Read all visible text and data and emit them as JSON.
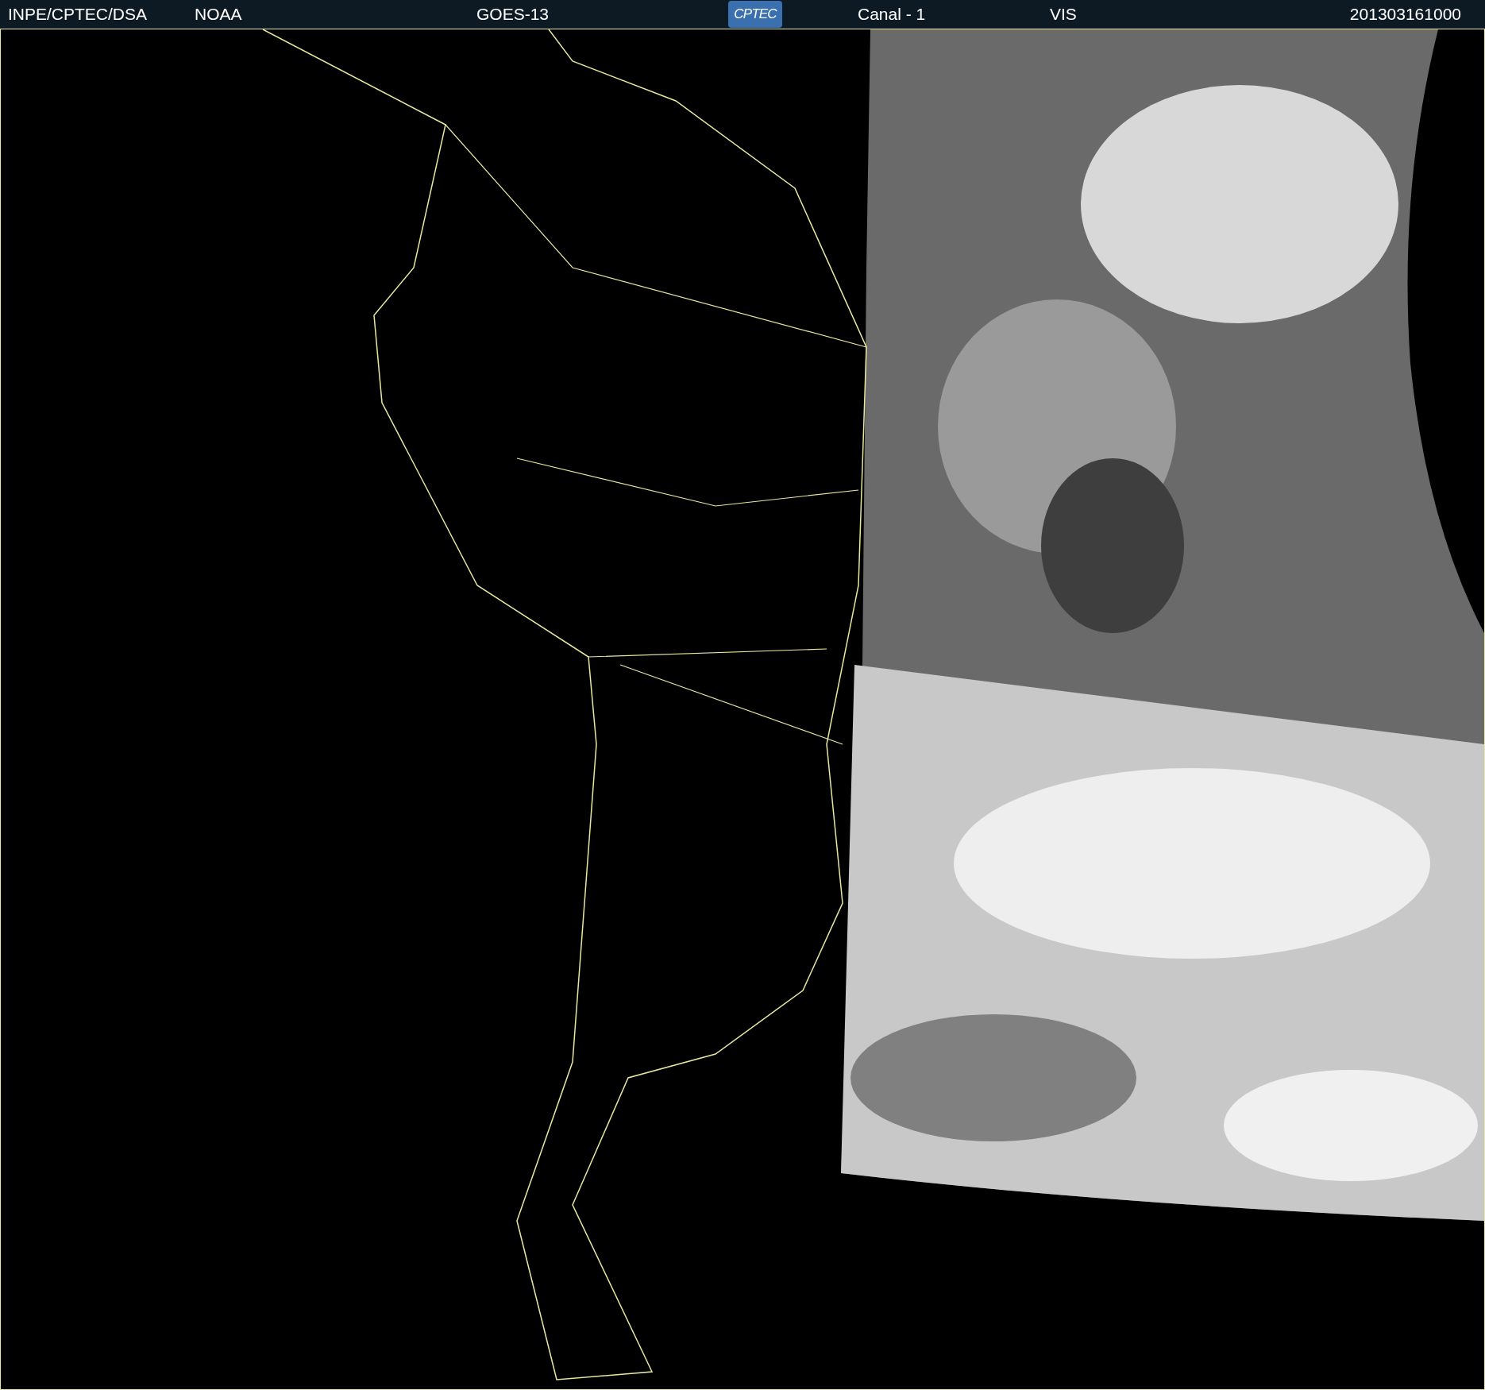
{
  "header": {
    "items": [
      "INPE/CPTEC/DSA",
      "NOAA",
      "GOES-13"
    ],
    "logo": "CPTEC",
    "channel": "Canal - 1",
    "band": "VIS",
    "timestamp": "201303161000"
  }
}
